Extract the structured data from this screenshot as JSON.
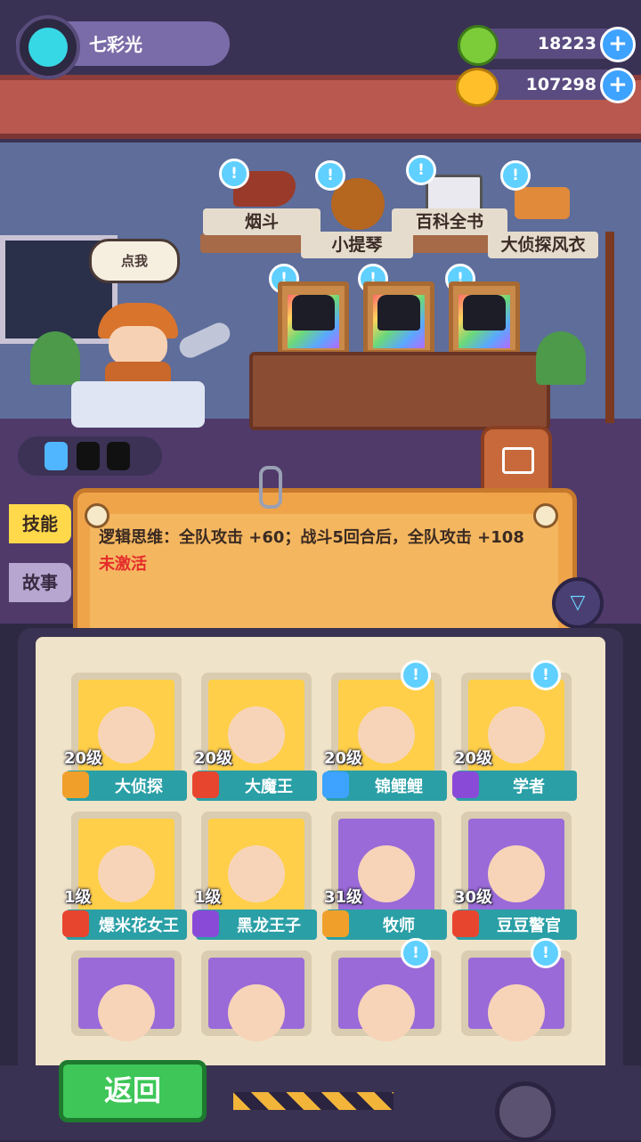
{
  "player": {
    "name": "七彩光"
  },
  "currency": {
    "green_coins": "18223",
    "gold_coins": "107298"
  },
  "scene": {
    "tap_hint": "点我",
    "hint_mark": "!",
    "collectibles": [
      "烟斗",
      "小提琴",
      "百科全书",
      "大侦探风衣"
    ]
  },
  "side_tabs": {
    "skill": "技能",
    "story": "故事"
  },
  "skill_panel": {
    "text": "逻辑思维：全队攻击 +60；战斗5回合后，全队攻击 +108",
    "status": "未激活"
  },
  "roster": [
    {
      "level": "20级",
      "name": "大侦探",
      "role_color": "#f0a02a",
      "bg": "#ffcf4a",
      "hint": false
    },
    {
      "level": "20级",
      "name": "大魔王",
      "role_color": "#e8452f",
      "bg": "#ffcf4a",
      "hint": false
    },
    {
      "level": "20级",
      "name": "锦鲤鲤",
      "role_color": "#3ea2ff",
      "bg": "#ffcf4a",
      "hint": true
    },
    {
      "level": "20级",
      "name": "学者",
      "role_color": "#8a4ad8",
      "bg": "#ffcf4a",
      "hint": true
    },
    {
      "level": "1级",
      "name": "爆米花女王",
      "role_color": "#e8452f",
      "bg": "#ffcf4a",
      "hint": false
    },
    {
      "level": "1级",
      "name": "黑龙王子",
      "role_color": "#8a4ad8",
      "bg": "#ffcf4a",
      "hint": false
    },
    {
      "level": "31级",
      "name": "牧师",
      "role_color": "#f0a02a",
      "bg": "#9a6ad8",
      "hint": false
    },
    {
      "level": "30级",
      "name": "豆豆警官",
      "role_color": "#e8452f",
      "bg": "#9a6ad8",
      "hint": false
    },
    {
      "level": "",
      "name": "",
      "role_color": "#f0a02a",
      "bg": "#9a6ad8",
      "hint": false
    },
    {
      "level": "",
      "name": "",
      "role_color": "#f0a02a",
      "bg": "#9a6ad8",
      "hint": false
    },
    {
      "level": "",
      "name": "",
      "role_color": "#f0a02a",
      "bg": "#9a6ad8",
      "hint": true
    },
    {
      "level": "",
      "name": "",
      "role_color": "#f0a02a",
      "bg": "#9a6ad8",
      "hint": true
    }
  ],
  "buttons": {
    "back": "返回",
    "add": "+"
  },
  "icons": {
    "filter": "filter-icon",
    "plus": "plus-icon",
    "avatar": "cat-avatar-icon"
  }
}
